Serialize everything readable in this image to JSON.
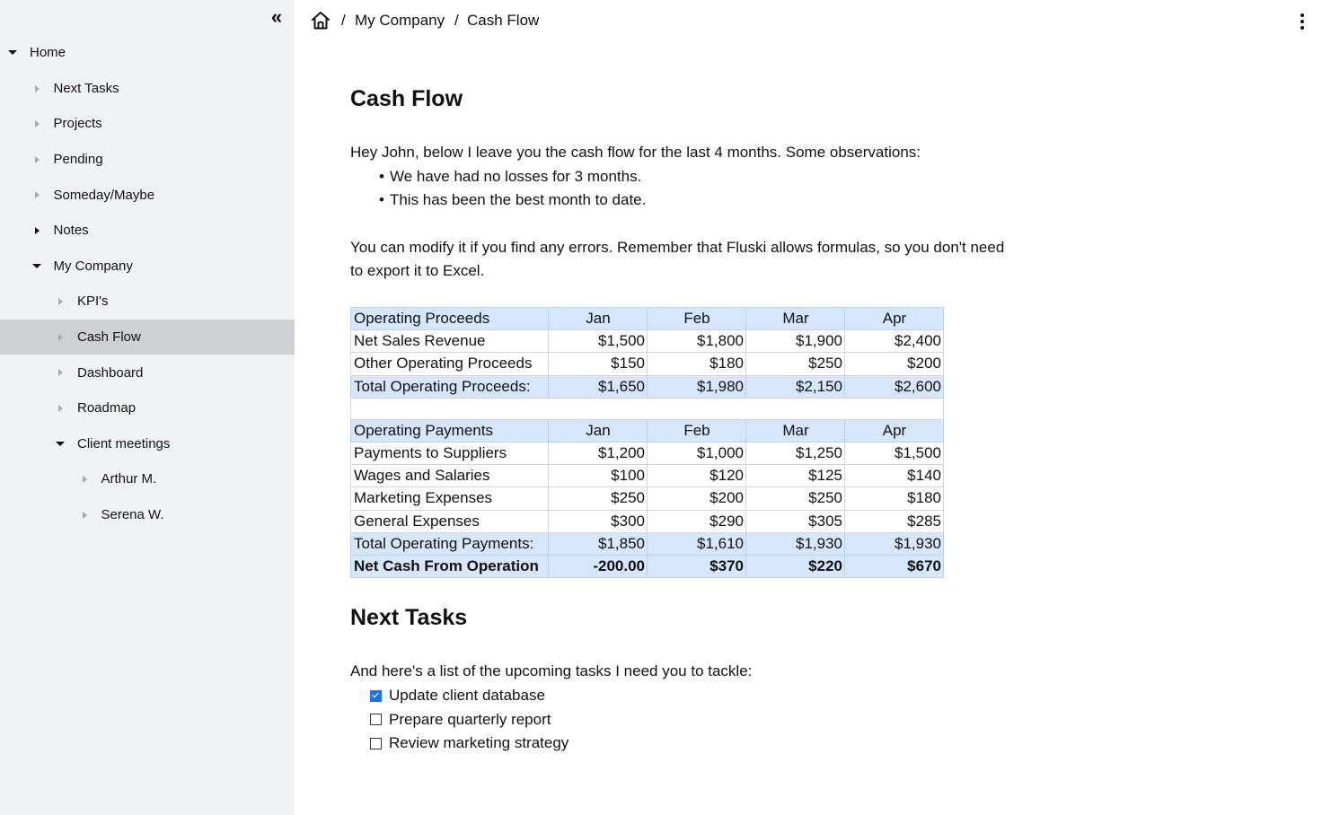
{
  "sidebar": {
    "collapse_icon": "double-chevron-left-icon",
    "items": [
      {
        "label": "Home",
        "level": 0,
        "state": "expanded",
        "active": false
      },
      {
        "label": "Next Tasks",
        "level": 1,
        "state": "collapsed-empty",
        "active": false
      },
      {
        "label": "Projects",
        "level": 1,
        "state": "collapsed-empty",
        "active": false
      },
      {
        "label": "Pending",
        "level": 1,
        "state": "collapsed-empty",
        "active": false
      },
      {
        "label": "Someday/Maybe",
        "level": 1,
        "state": "collapsed-empty",
        "active": false
      },
      {
        "label": "Notes",
        "level": 1,
        "state": "collapsed",
        "active": false
      },
      {
        "label": "My Company",
        "level": 1,
        "state": "expanded",
        "active": false
      },
      {
        "label": "KPI's",
        "level": 2,
        "state": "collapsed-empty",
        "active": false
      },
      {
        "label": "Cash Flow",
        "level": 2,
        "state": "collapsed-empty",
        "active": true
      },
      {
        "label": "Dashboard",
        "level": 2,
        "state": "collapsed-empty",
        "active": false
      },
      {
        "label": "Roadmap",
        "level": 2,
        "state": "collapsed-empty",
        "active": false
      },
      {
        "label": "Client meetings",
        "level": 2,
        "state": "expanded",
        "active": false
      },
      {
        "label": "Arthur M.",
        "level": 3,
        "state": "collapsed-empty",
        "active": false
      },
      {
        "label": "Serena W.",
        "level": 3,
        "state": "collapsed-empty",
        "active": false
      }
    ]
  },
  "breadcrumb": {
    "home_icon": "home-icon",
    "separator": "/",
    "items": [
      "My Company",
      "Cash Flow"
    ],
    "menu_icon": "more-vertical-icon"
  },
  "page": {
    "title": "Cash Flow",
    "intro": "Hey John, below I leave you the cash flow for the last 4 months. Some observations:",
    "bullets": [
      "We have had no losses for 3 months.",
      "This has been the best month to date."
    ],
    "note_line1": "You can modify it if you find any errors. Remember that Fluski allows formulas, so you don't need",
    "note_line2": "to export it to Excel.",
    "table": {
      "proceeds_header": [
        "Operating Proceeds",
        "Jan",
        "Feb",
        "Mar",
        "Apr"
      ],
      "proceeds_rows": [
        [
          "Net Sales Revenue",
          "$1,500",
          "$1,800",
          "$1,900",
          "$2,400"
        ],
        [
          "Other Operating Proceeds",
          "$150",
          "$180",
          "$250",
          "$200"
        ]
      ],
      "proceeds_total": [
        "Total Operating Proceeds:",
        "$1,650",
        "$1,980",
        "$2,150",
        "$2,600"
      ],
      "payments_header": [
        "Operating Payments",
        "Jan",
        "Feb",
        "Mar",
        "Apr"
      ],
      "payments_rows": [
        [
          "Payments to Suppliers",
          "$1,200",
          "$1,000",
          "$1,250",
          "$1,500"
        ],
        [
          "Wages and Salaries",
          "$100",
          "$120",
          "$125",
          "$140"
        ],
        [
          "Marketing Expenses",
          "$250",
          "$200",
          "$250",
          "$180"
        ],
        [
          "General Expenses",
          "$300",
          "$290",
          "$305",
          "$285"
        ]
      ],
      "payments_total": [
        "Total Operating Payments:",
        "$1,850",
        "$1,610",
        "$1,930",
        "$1,930"
      ],
      "net": [
        "Net Cash From Operation",
        "-200.00",
        "$370",
        "$220",
        "$670"
      ]
    },
    "tasks_title": "Next Tasks",
    "tasks_intro": "And here's a list of the upcoming tasks I need you to tackle:",
    "tasks": [
      {
        "label": "Update client database",
        "checked": true
      },
      {
        "label": "Prepare quarterly report",
        "checked": false
      },
      {
        "label": "Review marketing strategy",
        "checked": false
      }
    ]
  },
  "colors": {
    "sidebar_bg": "#f1f2f4",
    "active_item_bg": "#cfd0d3",
    "table_highlight": "#d6e6fb",
    "checkbox_checked": "#1a73e8"
  }
}
